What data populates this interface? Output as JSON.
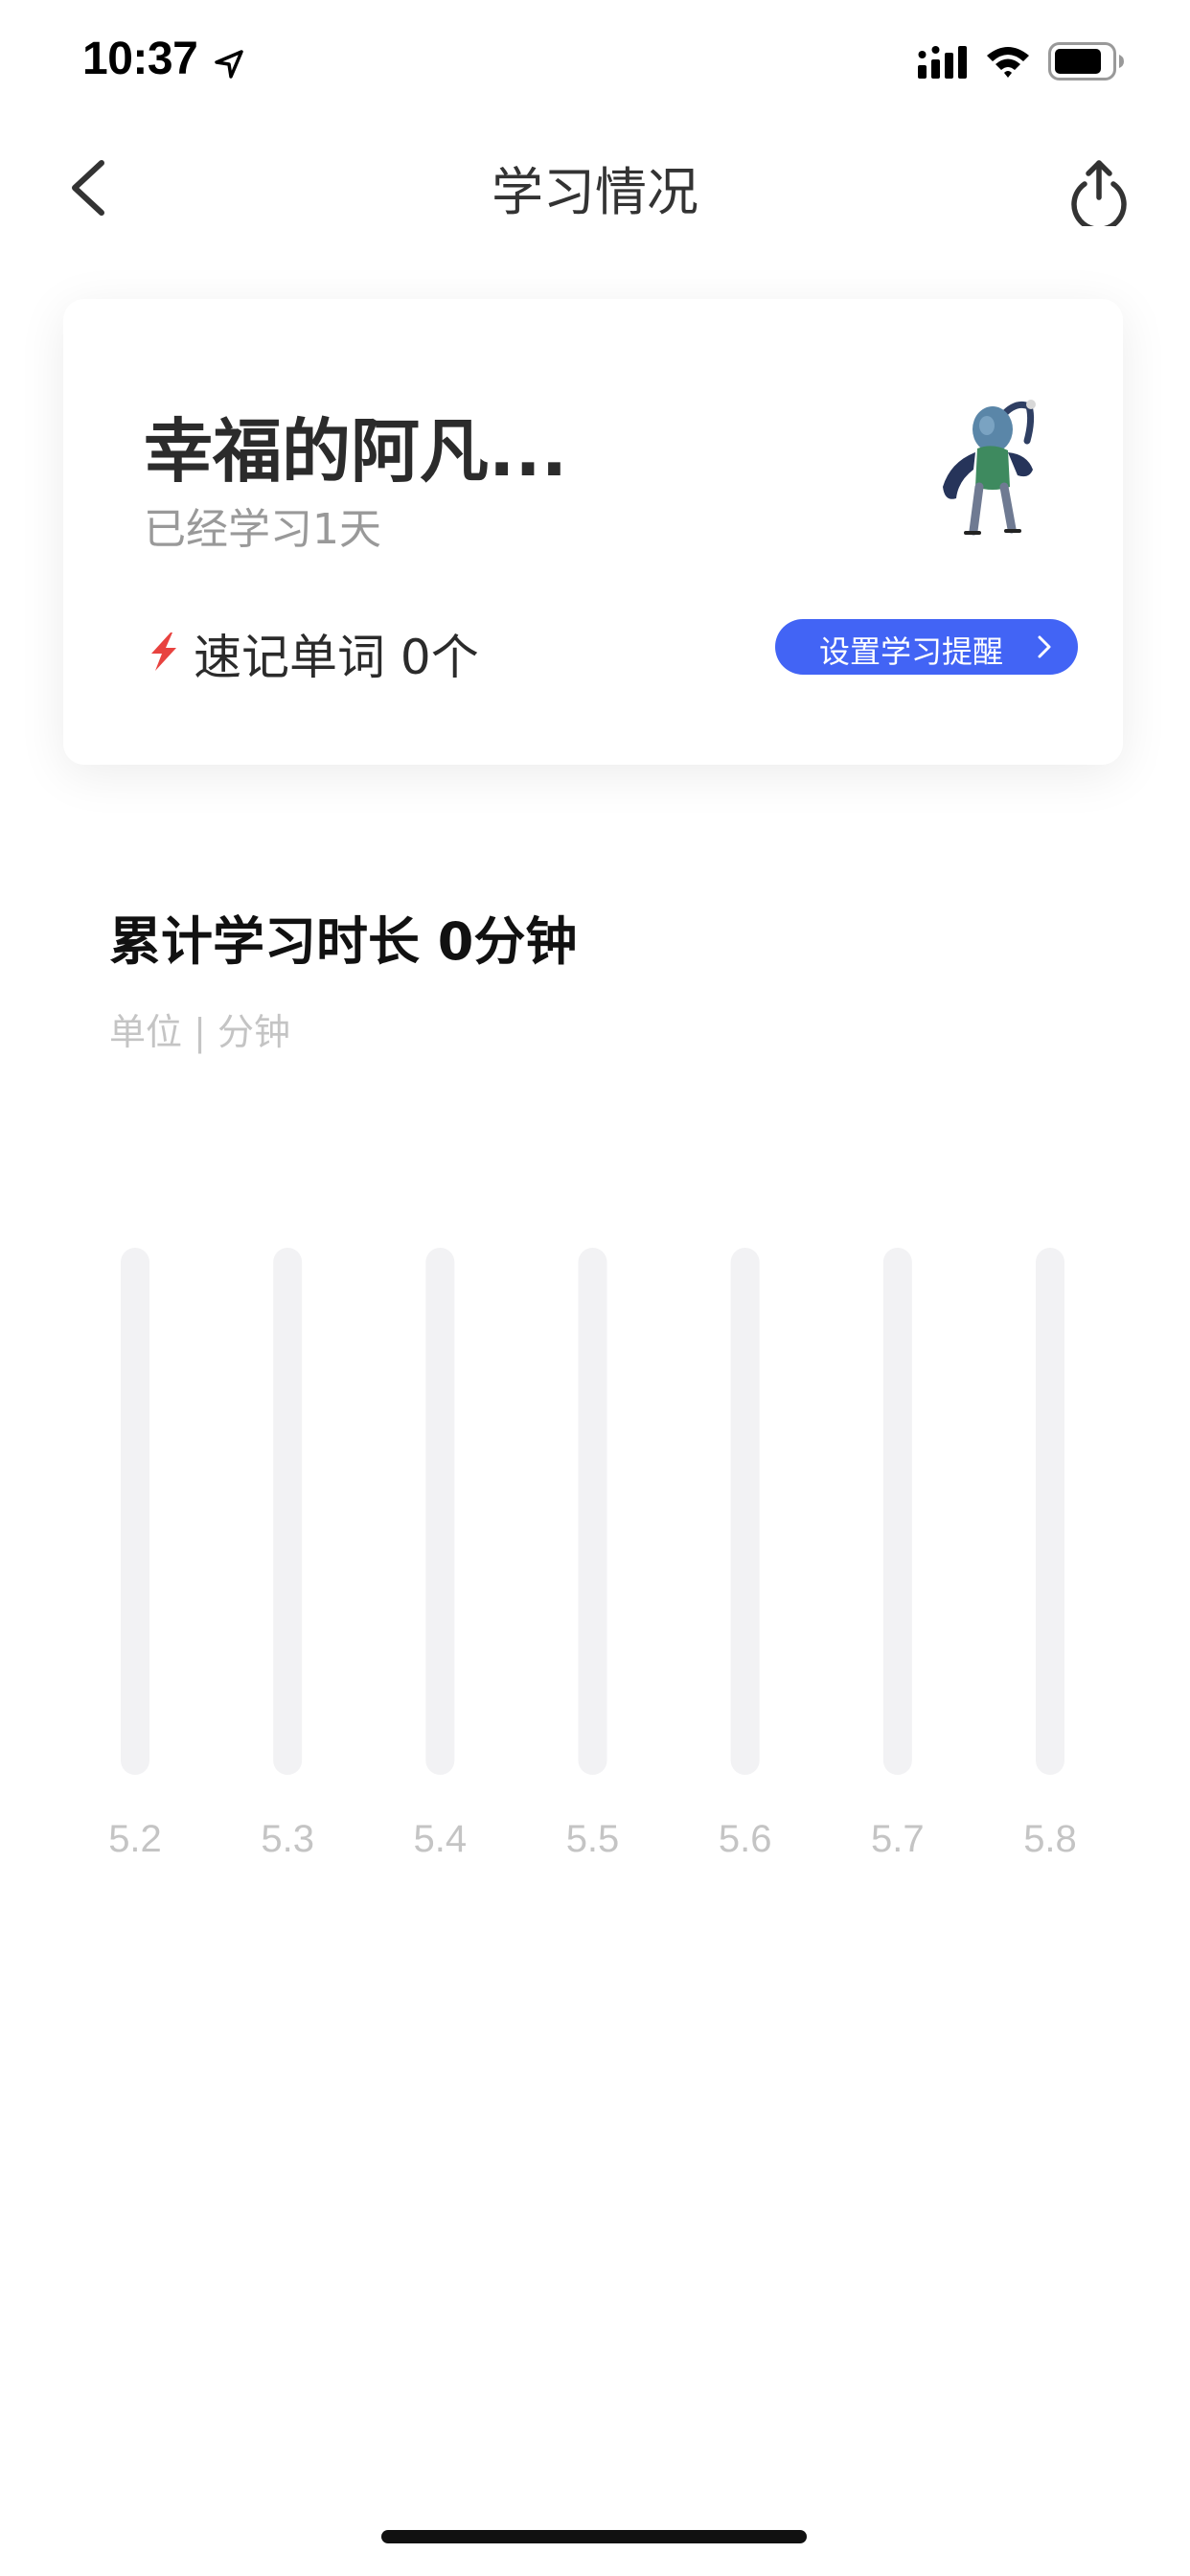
{
  "status_bar": {
    "time": "10:37",
    "icons": [
      "location-arrow-icon",
      "signal-icon",
      "wifi-icon",
      "battery-icon"
    ]
  },
  "nav": {
    "title": "学习情况",
    "back_icon": "chevron-left-icon",
    "share_icon": "share-icon"
  },
  "profile": {
    "name": "幸福的阿凡...",
    "study_days": "已经学习1天",
    "quick_words_label": "速记单词 0个",
    "quick_words_icon": "lightning-icon",
    "reminder_button": "设置学习提醒",
    "colors": {
      "accent": "#4264f5",
      "lightning": "#e8423f"
    }
  },
  "chart": {
    "title": "累计学习时长 0分钟",
    "unit": "单位 | 分钟"
  },
  "chart_data": {
    "type": "bar",
    "categories": [
      "5.2",
      "5.3",
      "5.4",
      "5.5",
      "5.6",
      "5.7",
      "5.8"
    ],
    "values": [
      0,
      0,
      0,
      0,
      0,
      0,
      0
    ],
    "title": "",
    "xlabel": "",
    "ylabel": "",
    "track_color": "#f2f2f4",
    "bar_color": "#4264f5",
    "label_color": "#c4c4c4",
    "grid": false
  }
}
